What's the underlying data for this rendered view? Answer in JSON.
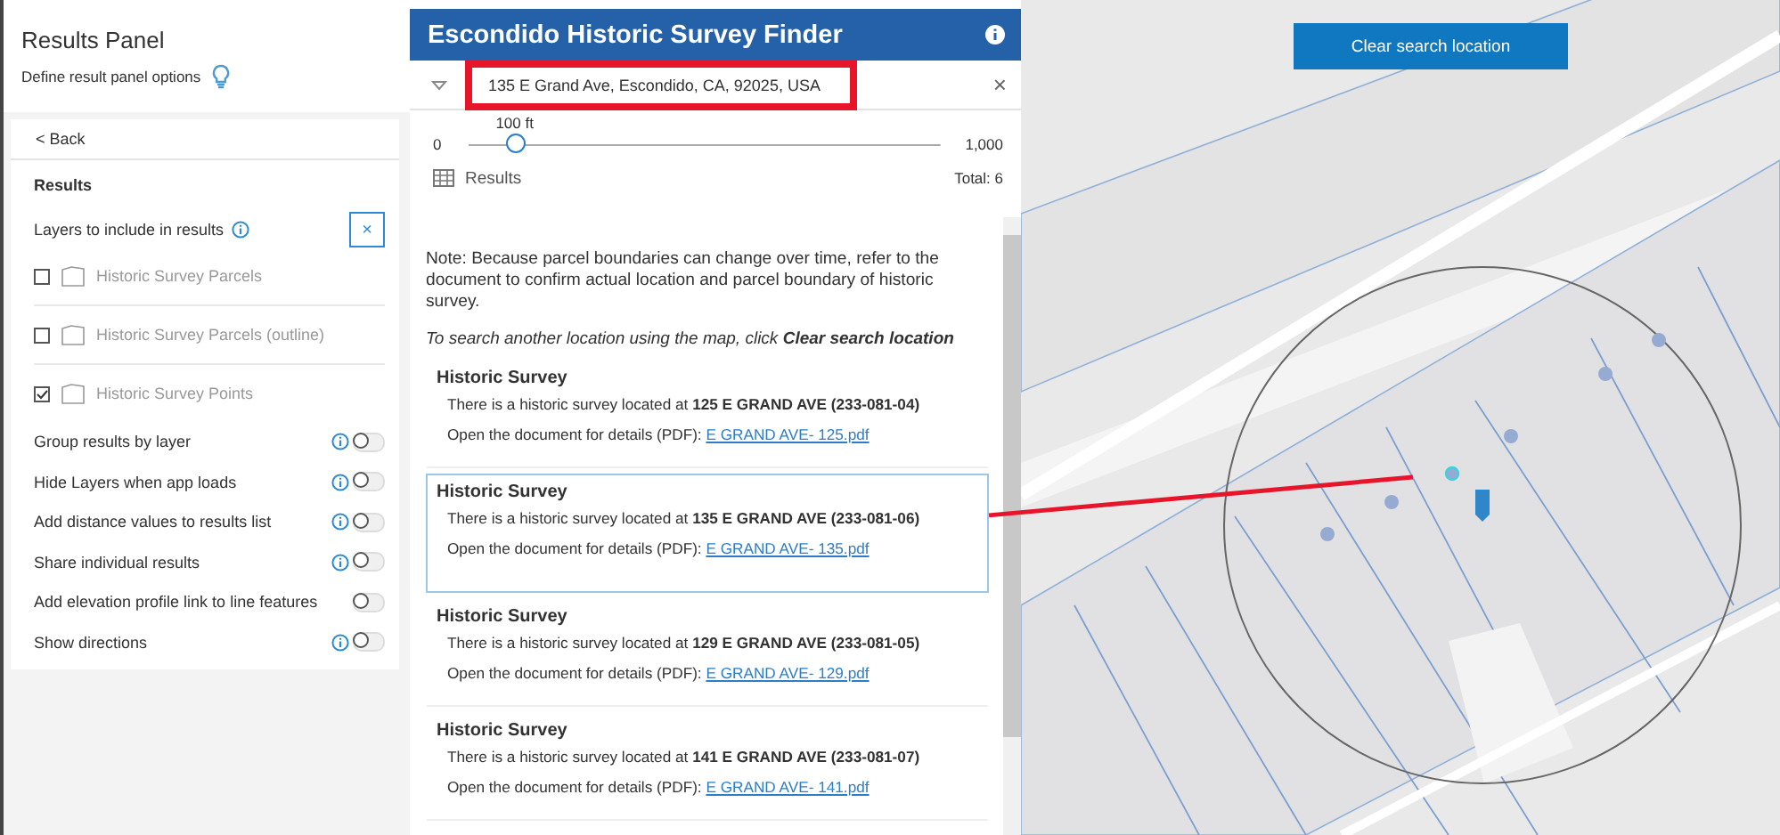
{
  "config_panel": {
    "title": "Results Panel",
    "subtitle": "Define result panel options",
    "back": "< Back",
    "section": "Results",
    "layers_label": "Layers to include in results",
    "clear": "×",
    "layers": [
      {
        "label": "Historic Survey Parcels",
        "checked": false
      },
      {
        "label": "Historic Survey Parcels (outline)",
        "checked": false
      },
      {
        "label": "Historic Survey Points",
        "checked": true
      }
    ],
    "options": [
      {
        "label": "Group results by layer",
        "info": true,
        "on": false
      },
      {
        "label": "Hide Layers when app loads",
        "info": true,
        "on": false
      },
      {
        "label": "Add distance values to results list",
        "info": true,
        "on": false
      },
      {
        "label": "Share individual results",
        "info": true,
        "on": false
      },
      {
        "label": "Add elevation profile link to line features",
        "info": false,
        "on": false
      },
      {
        "label": "Show directions",
        "info": true,
        "on": false
      }
    ]
  },
  "app": {
    "title": "Escondido Historic Survey Finder",
    "search": {
      "value": "135 E Grand Ave, Escondido, CA, 92025, USA",
      "annotated": true,
      "clear": "×"
    },
    "distance": {
      "reading": "100 ft",
      "min": "0",
      "max": "1,000",
      "level": 0.1
    },
    "results": {
      "label": "Results",
      "total": "Total: 6"
    },
    "note": "Note: Because parcel boundaries can change over time, refer to the document to confirm actual location and parcel boundary of historic survey.",
    "hint": "To search another location using the map, click **Clear search location**",
    "cards": [
      {
        "title": "Historic Survey",
        "text": "There is a historic survey located at **125 E GRAND AVE (233-081-04)**",
        "prompt": "Open the document for details (PDF):",
        "link": "E GRAND AVE- 125.pdf",
        "selected": false,
        "callout": false
      },
      {
        "title": "Historic Survey",
        "text": "There is a historic survey located at **135 E GRAND AVE (233-081-06)**",
        "prompt": "Open the document for details (PDF):",
        "link": "E GRAND AVE- 135.pdf",
        "selected": true,
        "callout": true
      },
      {
        "title": "Historic Survey",
        "text": "There is a historic survey located at **129 E GRAND AVE (233-081-05)**",
        "prompt": "Open the document for details (PDF):",
        "link": "E GRAND AVE- 129.pdf",
        "selected": false,
        "callout": false
      },
      {
        "title": "Historic Survey",
        "text": "There is a historic survey located at **141 E GRAND AVE (233-081-07)**",
        "prompt": "Open the document for details (PDF):",
        "link": "E GRAND AVE- 141.pdf",
        "selected": false,
        "callout": false
      }
    ]
  },
  "map": {
    "kind": "picture",
    "button": "Clear search location"
  }
}
